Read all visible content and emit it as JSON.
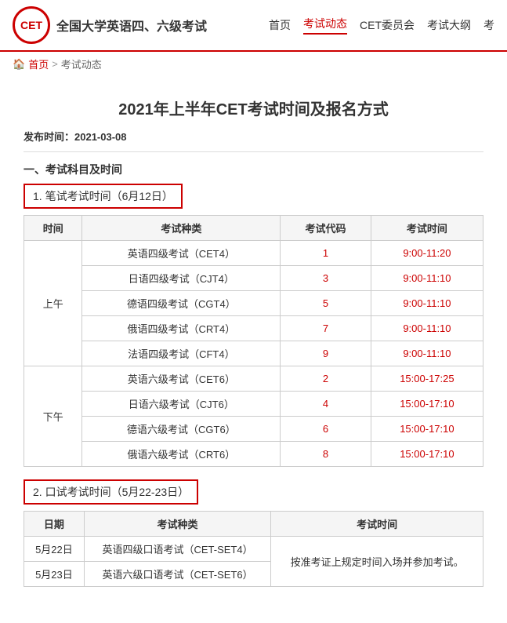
{
  "header": {
    "logo_text": "CET",
    "site_name": "全国大学英语四、六级考试",
    "nav": [
      {
        "label": "首页",
        "active": false
      },
      {
        "label": "考试动态",
        "active": true
      },
      {
        "label": "CET委员会",
        "active": false
      },
      {
        "label": "考试大纲",
        "active": false
      },
      {
        "label": "考",
        "active": false
      }
    ]
  },
  "breadcrumb": {
    "home": "首页",
    "separator": ">",
    "current": "考试动态"
  },
  "page": {
    "title": "2021年上半年CET考试时间及报名方式",
    "publish_label": "发布时间：",
    "publish_date": "2021-03-08",
    "section1_title": "一、考试科目及时间",
    "written_label": "1. 笔试考试时间（6月12日）",
    "oral_label": "2. 口试考试时间（5月22-23日）"
  },
  "written_table": {
    "headers": [
      "时间",
      "考试种类",
      "考试代码",
      "考试时间"
    ],
    "rows": [
      {
        "period": "上午",
        "name": "英语四级考试（CET4）",
        "code": "1",
        "time": "9:00-11:20",
        "rowspan": 5
      },
      {
        "period": "",
        "name": "日语四级考试（CJT4）",
        "code": "3",
        "time": "9:00-11:10",
        "rowspan": 0
      },
      {
        "period": "",
        "name": "德语四级考试（CGT4）",
        "code": "5",
        "time": "9:00-11:10",
        "rowspan": 0
      },
      {
        "period": "",
        "name": "俄语四级考试（CRT4）",
        "code": "7",
        "time": "9:00-11:10",
        "rowspan": 0
      },
      {
        "period": "",
        "name": "法语四级考试（CFT4）",
        "code": "9",
        "time": "9:00-11:10",
        "rowspan": 0
      },
      {
        "period": "下午",
        "name": "英语六级考试（CET6）",
        "code": "2",
        "time": "15:00-17:25",
        "rowspan": 4
      },
      {
        "period": "",
        "name": "日语六级考试（CJT6）",
        "code": "4",
        "time": "15:00-17:10",
        "rowspan": 0
      },
      {
        "period": "",
        "name": "德语六级考试（CGT6）",
        "code": "6",
        "time": "15:00-17:10",
        "rowspan": 0
      },
      {
        "period": "",
        "name": "俄语六级考试（CRT6）",
        "code": "8",
        "time": "15:00-17:10",
        "rowspan": 0
      }
    ]
  },
  "oral_table": {
    "headers": [
      "日期",
      "考试种类",
      "考试时间"
    ],
    "rows": [
      {
        "date": "5月22日",
        "name": "英语四级口语考试（CET-SET4）",
        "time": "按准考证上规定时间入场并参加考试。"
      },
      {
        "date": "5月23日",
        "name": "英语六级口语考试（CET-SET6）",
        "time": ""
      }
    ]
  }
}
